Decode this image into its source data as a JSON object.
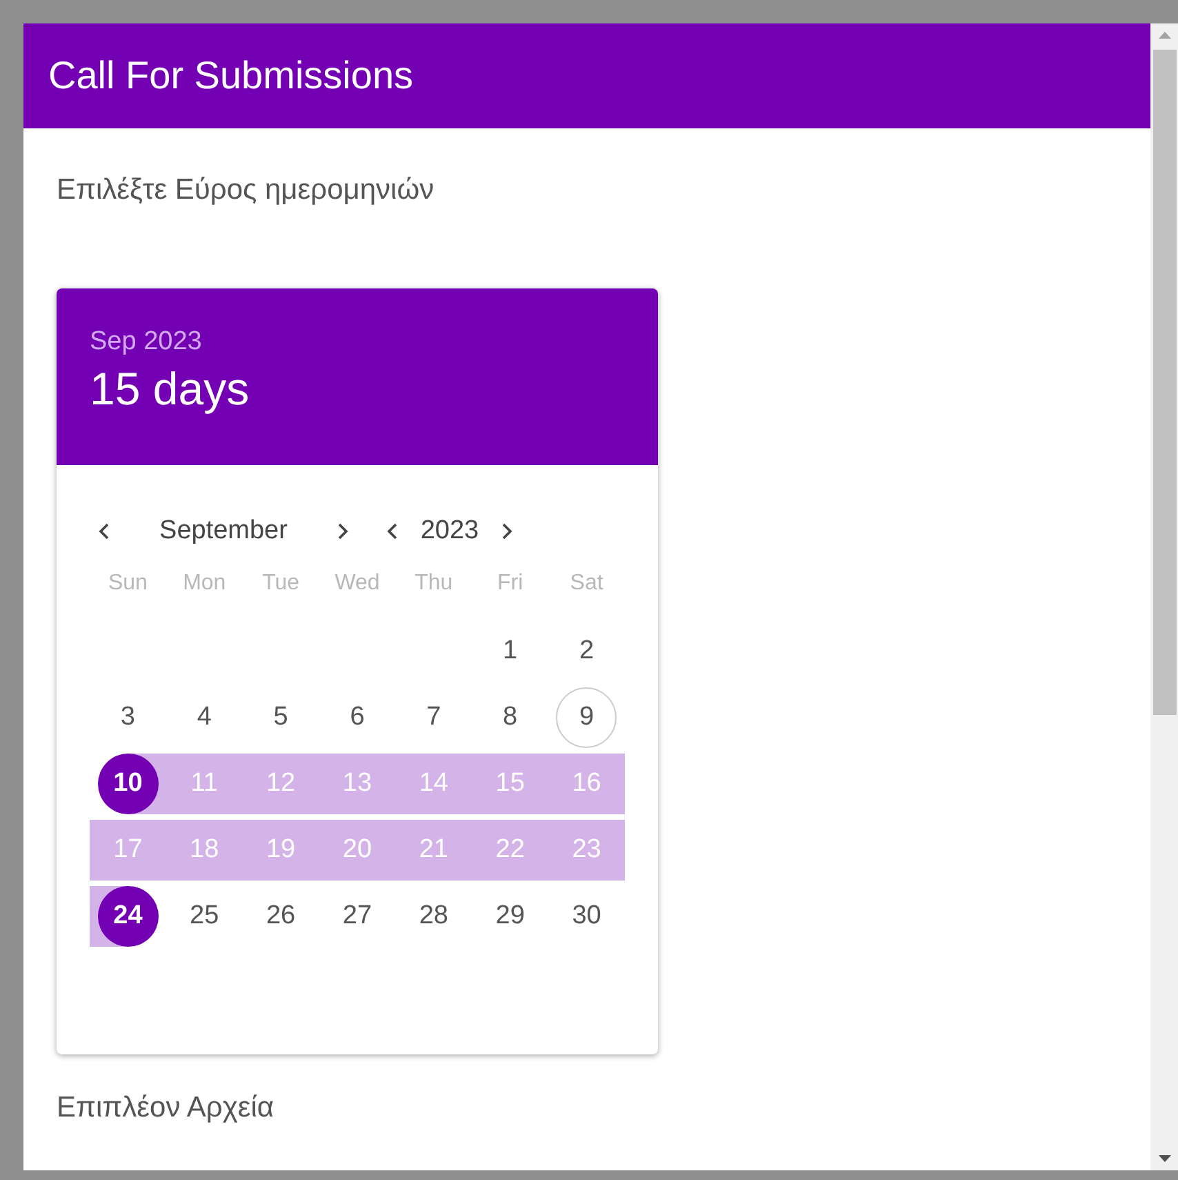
{
  "dialog": {
    "title": "Call For Submissions",
    "prompt": "Επιλέξτε Εύρος ημερομηνιών",
    "next_section": "Επιπλέον Αρχεία"
  },
  "picker": {
    "header_month": "Sep 2023",
    "header_count": "15 days",
    "month": "September",
    "year": "2023",
    "weekdays": [
      "Sun",
      "Mon",
      "Tue",
      "Wed",
      "Thu",
      "Fri",
      "Sat"
    ],
    "weeks": [
      [
        {
          "day": "1",
          "selected": false,
          "in_range": false,
          "today": false
        },
        {
          "day": "2",
          "selected": false,
          "in_range": false,
          "today": false
        }
      ],
      [
        {
          "day": "3",
          "selected": false,
          "in_range": false,
          "today": false
        },
        {
          "day": "4",
          "selected": false,
          "in_range": false,
          "today": false
        },
        {
          "day": "5",
          "selected": false,
          "in_range": false,
          "today": false
        },
        {
          "day": "6",
          "selected": false,
          "in_range": false,
          "today": false
        },
        {
          "day": "7",
          "selected": false,
          "in_range": false,
          "today": false
        },
        {
          "day": "8",
          "selected": false,
          "in_range": false,
          "today": false
        },
        {
          "day": "9",
          "selected": false,
          "in_range": false,
          "today": true
        }
      ],
      [
        {
          "day": "10",
          "selected": true,
          "in_range": true,
          "today": false
        },
        {
          "day": "11",
          "selected": false,
          "in_range": true,
          "today": false
        },
        {
          "day": "12",
          "selected": false,
          "in_range": true,
          "today": false
        },
        {
          "day": "13",
          "selected": false,
          "in_range": true,
          "today": false
        },
        {
          "day": "14",
          "selected": false,
          "in_range": true,
          "today": false
        },
        {
          "day": "15",
          "selected": false,
          "in_range": true,
          "today": false
        },
        {
          "day": "16",
          "selected": false,
          "in_range": true,
          "today": false
        }
      ],
      [
        {
          "day": "17",
          "selected": false,
          "in_range": true,
          "today": false
        },
        {
          "day": "18",
          "selected": false,
          "in_range": true,
          "today": false
        },
        {
          "day": "19",
          "selected": false,
          "in_range": true,
          "today": false
        },
        {
          "day": "20",
          "selected": false,
          "in_range": true,
          "today": false
        },
        {
          "day": "21",
          "selected": false,
          "in_range": true,
          "today": false
        },
        {
          "day": "22",
          "selected": false,
          "in_range": true,
          "today": false
        },
        {
          "day": "23",
          "selected": false,
          "in_range": true,
          "today": false
        }
      ],
      [
        {
          "day": "24",
          "selected": true,
          "in_range": true,
          "today": false
        },
        {
          "day": "25",
          "selected": false,
          "in_range": false,
          "today": false
        },
        {
          "day": "26",
          "selected": false,
          "in_range": false,
          "today": false
        },
        {
          "day": "27",
          "selected": false,
          "in_range": false,
          "today": false
        },
        {
          "day": "28",
          "selected": false,
          "in_range": false,
          "today": false
        },
        {
          "day": "29",
          "selected": false,
          "in_range": false,
          "today": false
        },
        {
          "day": "30",
          "selected": false,
          "in_range": false,
          "today": false
        }
      ]
    ]
  }
}
